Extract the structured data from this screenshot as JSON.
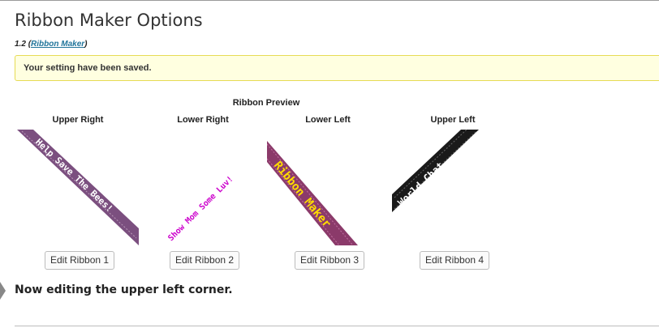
{
  "page": {
    "title": "Ribbon Maker Options",
    "version": "1.2",
    "plugin_link": "Ribbon Maker"
  },
  "notice": {
    "message": "Your setting have been saved."
  },
  "preview": {
    "heading": "Ribbon Preview",
    "corners": [
      {
        "label": "Upper Right",
        "ribbon_text": "Help Save The Bees!",
        "ribbon_color": "#7b4f7f",
        "text_color": "#ffffff",
        "edit_label": "Edit Ribbon 1"
      },
      {
        "label": "Lower Right",
        "ribbon_text": "Show Mom Some Luv!",
        "ribbon_color": "transparent",
        "text_color": "#cc00cc",
        "edit_label": "Edit Ribbon 2"
      },
      {
        "label": "Lower Left",
        "ribbon_text": "Ribbon Maker",
        "ribbon_color": "#8b3a6a",
        "text_color": "#ffdd00",
        "edit_label": "Edit Ribbon 3"
      },
      {
        "label": "Upper Left",
        "ribbon_text": "World Chat",
        "ribbon_color": "#1a1a1a",
        "text_color": "#ffffff",
        "edit_label": "Edit Ribbon 4"
      }
    ]
  },
  "editing": {
    "message": "Now editing the upper left corner."
  }
}
